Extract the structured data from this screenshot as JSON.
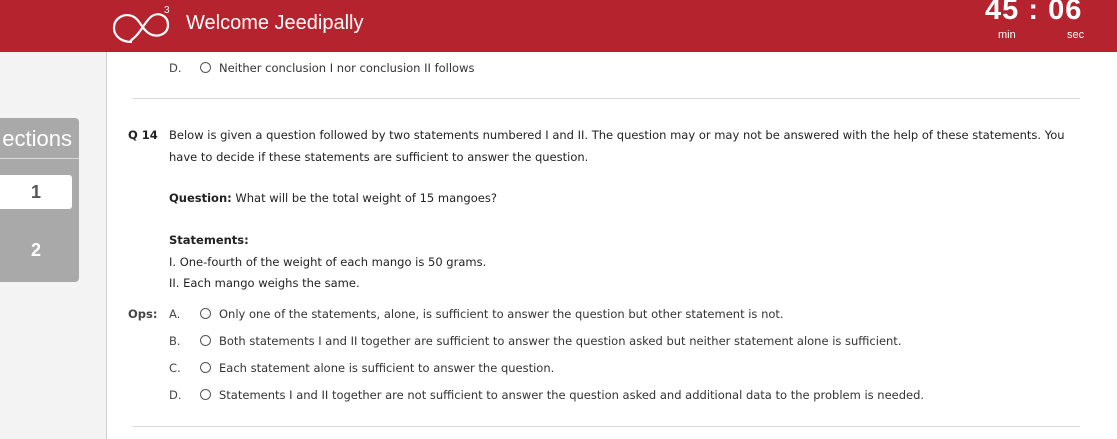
{
  "header": {
    "welcome": "Welcome Jeedipally",
    "timer": {
      "minutes": "45",
      "separator": ":",
      "seconds": "06",
      "min_label": "min",
      "sec_label": "sec"
    },
    "colors": {
      "bar": "#b5242e"
    }
  },
  "sections": {
    "title": "ections",
    "items": [
      "1",
      "2"
    ]
  },
  "prev_question": {
    "last_option": {
      "letter": "D.",
      "text": "Neither conclusion I nor conclusion II follows"
    }
  },
  "question": {
    "number": "Q 14",
    "intro_line1": "Below is given a question followed by two statements numbered I and II. The question may or may not be answered with the help of these statements. You",
    "intro_line2": "have to decide if these statements are sufficient to answer the question.",
    "question_label": "Question:",
    "question_text": " What will be the total weight of 15 mangoes?",
    "statements_label": "Statements:",
    "statement1": "I. One-fourth of the weight of each mango is 50 grams.",
    "statement2": "II. Each mango weighs the same.",
    "ops_label": "Ops:",
    "options": [
      {
        "letter": "A.",
        "text": "Only one of the statements, alone, is sufficient to answer the question but other statement is not."
      },
      {
        "letter": "B.",
        "text": "Both statements I and II together are sufficient to answer the question asked but neither statement alone is sufficient."
      },
      {
        "letter": "C.",
        "text": "Each statement alone is sufficient to answer the question."
      },
      {
        "letter": "D.",
        "text": "Statements I and II together are not sufficient to answer the question asked and additional data to the problem is needed."
      }
    ]
  }
}
